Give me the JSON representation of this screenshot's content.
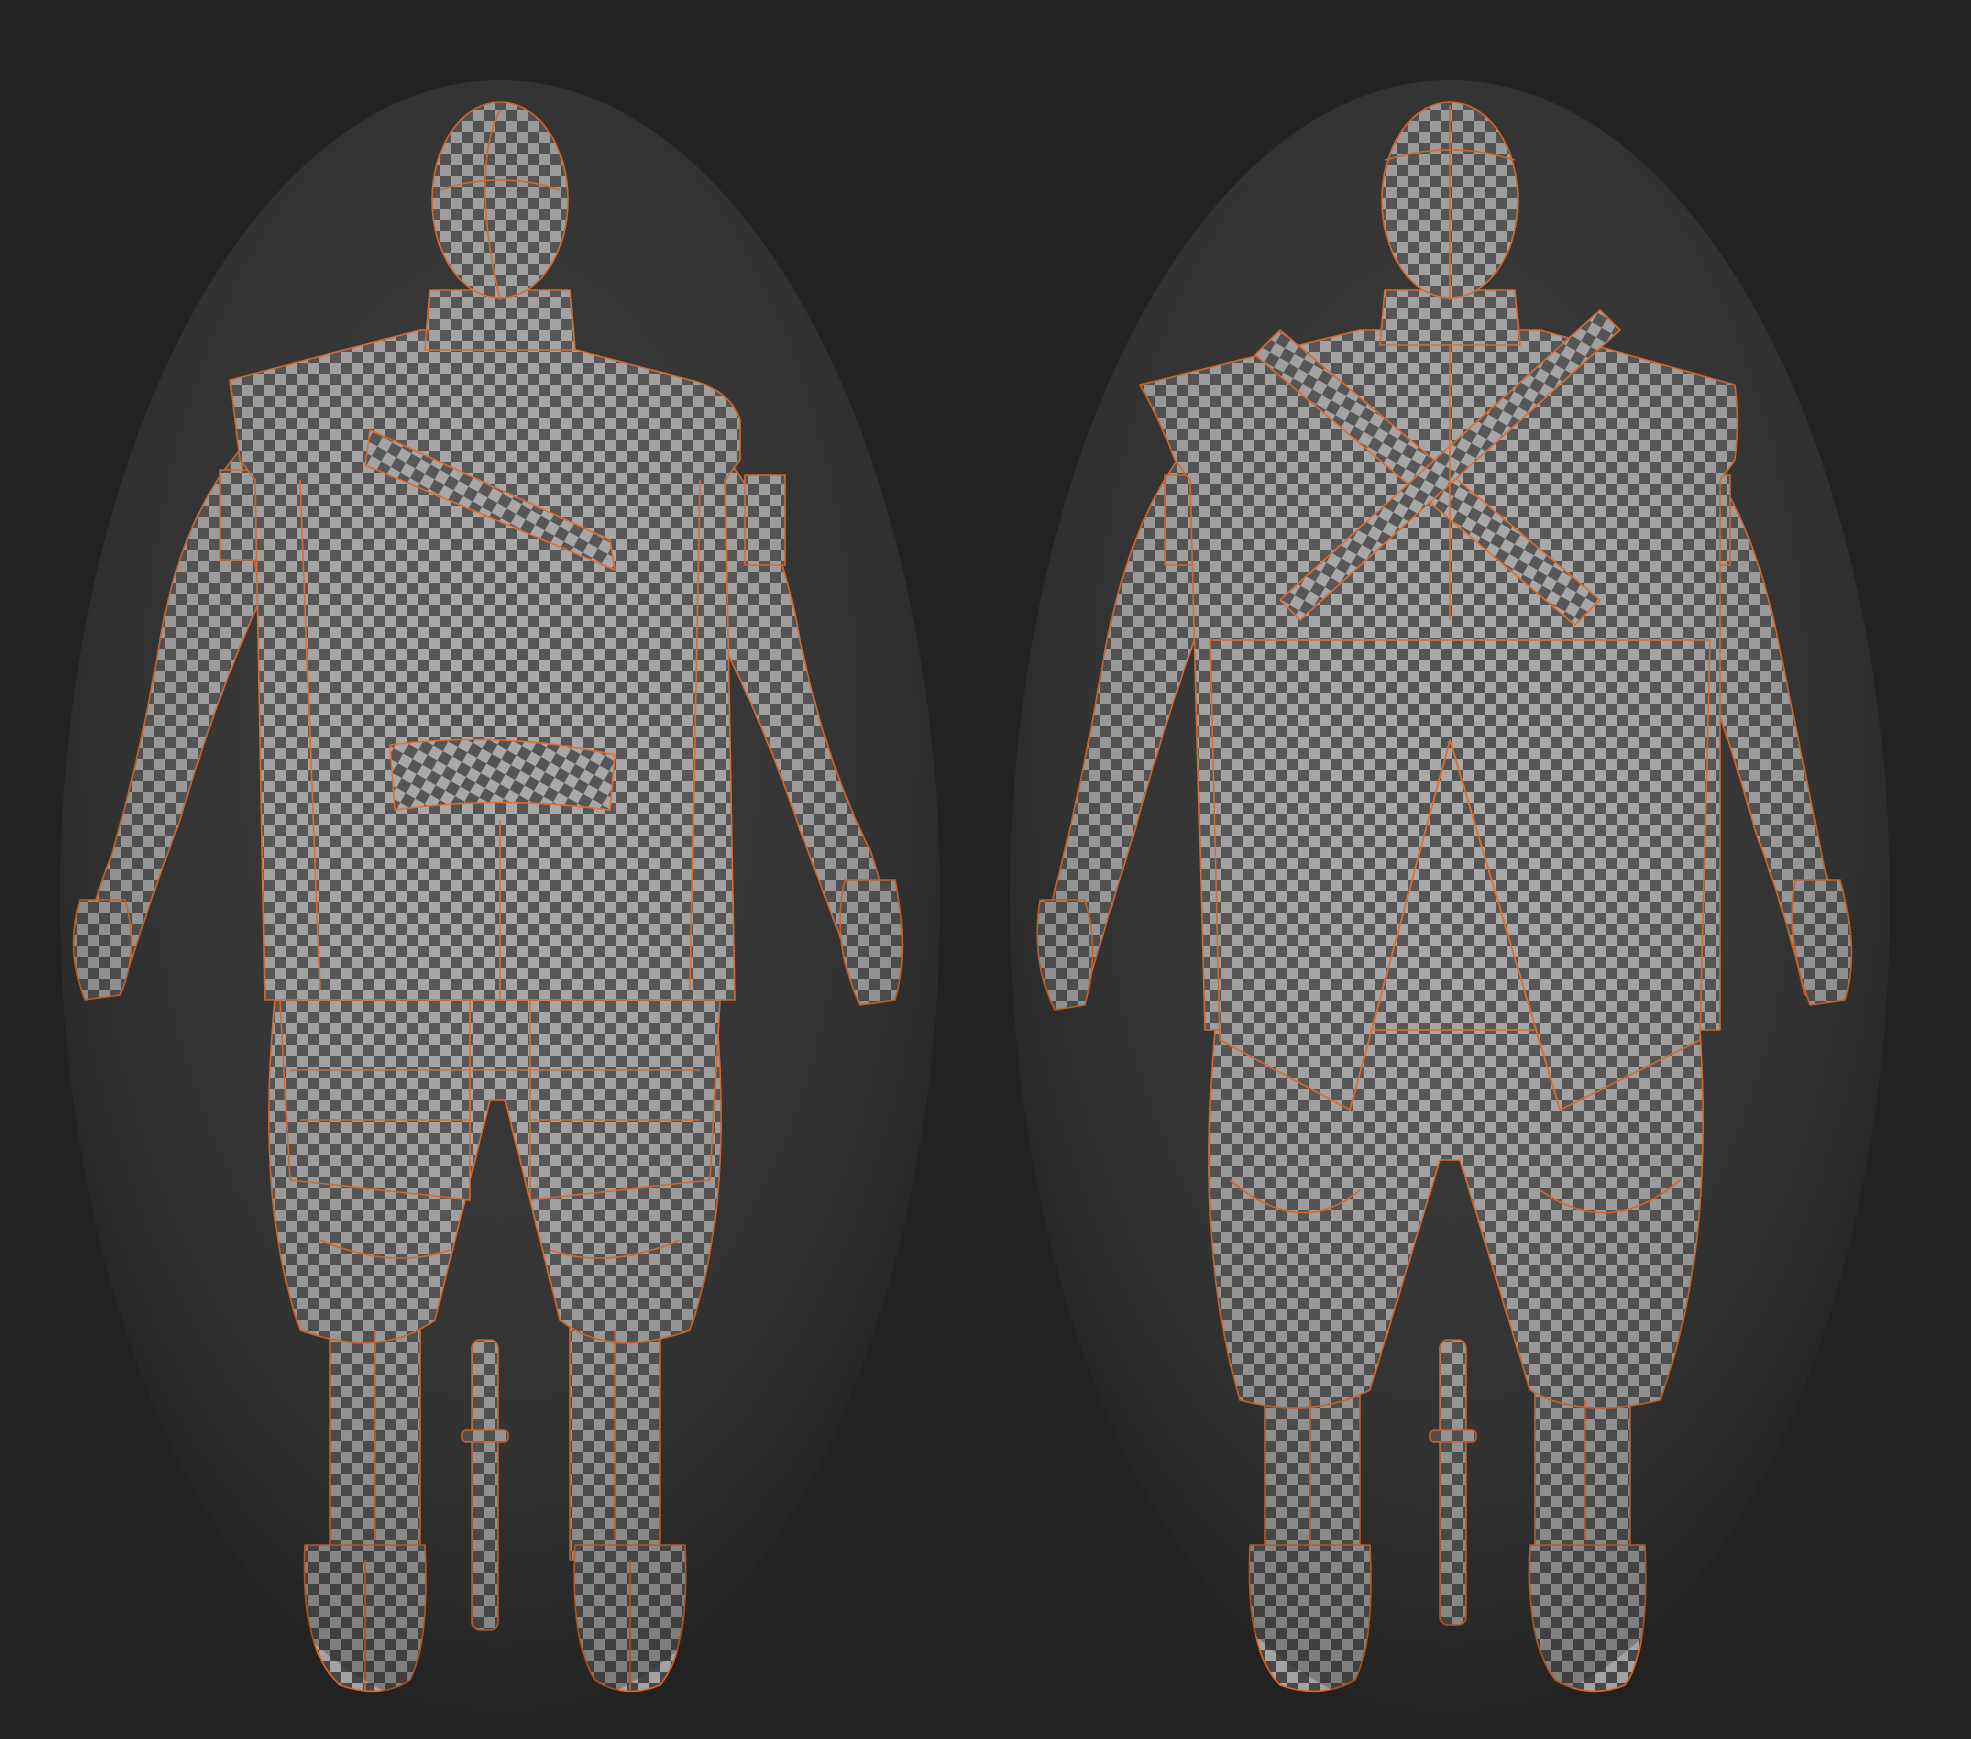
{
  "viewport": {
    "background": "#222222",
    "checker_light": "#a3a3a3",
    "checker_dark": "#474747",
    "seam_color": "#e0621e",
    "figures": [
      {
        "name": "front-view"
      },
      {
        "name": "back-view"
      }
    ]
  }
}
